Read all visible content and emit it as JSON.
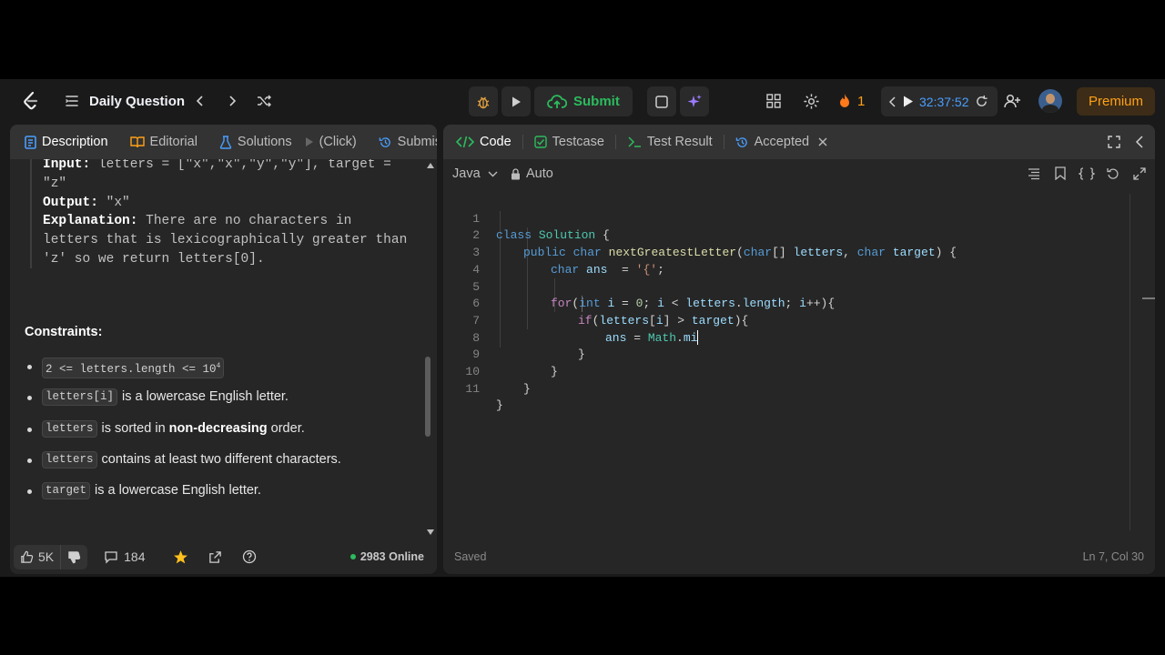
{
  "topbar": {
    "title": "Daily Question",
    "submit_label": "Submit",
    "streak_count": "1",
    "timer": "32:37:52",
    "premium_label": "Premium"
  },
  "left_tabs": [
    {
      "label": "Description",
      "icon": "description-icon"
    },
    {
      "label": "Editorial",
      "icon": "book-icon"
    },
    {
      "label": "Solutions",
      "icon": "flask-icon"
    },
    {
      "label": "(Click)",
      "icon": "cursor-icon"
    },
    {
      "label": "Submiss",
      "icon": "history-icon"
    }
  ],
  "example": {
    "input_label": "Input:",
    "input_value": "letters = [\"x\",\"x\",\"y\",\"y\"], target = \"z\"",
    "output_label": "Output:",
    "output_value": "\"x\"",
    "explanation_label": "Explanation:",
    "explanation_value": "There are no characters in letters that is lexicographically greater than 'z' so we return letters[0]."
  },
  "constraints": {
    "title": "Constraints:",
    "items": [
      {
        "code": "2 <= letters.length <= 10",
        "sup": "4",
        "text": ""
      },
      {
        "code": "letters[i]",
        "text": "is a lowercase English letter."
      },
      {
        "code": "letters",
        "text_before": "is sorted in ",
        "bold": "non-decreasing",
        "text_after": " order."
      },
      {
        "code": "letters",
        "text": "contains at least two different characters."
      },
      {
        "code": "target",
        "text": "is a lowercase English letter."
      }
    ]
  },
  "left_footer": {
    "likes": "5K",
    "comments": "184",
    "online": "2983 Online"
  },
  "right_tabs": [
    {
      "label": "Code",
      "icon": "code-icon"
    },
    {
      "label": "Testcase",
      "icon": "checkbox-icon"
    },
    {
      "label": "Test Result",
      "icon": "terminal-icon"
    },
    {
      "label": "Accepted",
      "icon": "history-icon"
    }
  ],
  "editor_toolbar": {
    "language": "Java",
    "mode": "Auto"
  },
  "code_lines": [
    "1",
    "2",
    "3",
    "4",
    "5",
    "6",
    "7",
    "8",
    "9",
    "10",
    "11"
  ],
  "code_text": {
    "l1_kw": "class",
    "l1_ty": "Solution",
    "l1_rest": " {",
    "l2_kw1": "public",
    "l2_kw2": "char",
    "l2_fn": "nextGreatestLetter",
    "l2_p1": "(",
    "l2_kw3": "char",
    "l2_p2": "[] ",
    "l2_v1": "letters",
    "l2_p3": ", ",
    "l2_kw4": "char",
    "l2_v2": "target",
    "l2_p4": ") {",
    "l3_kw": "char",
    "l3_v": "ans",
    "l3_op": "  = ",
    "l3_st": "'{'",
    "l3_end": ";",
    "l5_kw": "for",
    "l5_p1": "(",
    "l5_kw2": "int",
    "l5_v1": "i",
    "l5_p2": " = ",
    "l5_n": "0",
    "l5_p3": "; ",
    "l5_v2": "i",
    "l5_p4": " < ",
    "l5_v3": "letters",
    "l5_p5": ".",
    "l5_v4": "length",
    "l5_p6": "; ",
    "l5_v5": "i",
    "l5_p7": "++){",
    "l6_kw": "if",
    "l6_p1": "(",
    "l6_v1": "letters",
    "l6_p2": "[",
    "l6_v2": "i",
    "l6_p3": "] > ",
    "l6_v3": "target",
    "l6_p4": "){",
    "l7_v1": "ans",
    "l7_p1": " = ",
    "l7_ty": "Math",
    "l7_p2": ".",
    "l7_v2": "mi",
    "l8": "}",
    "l9": "}",
    "l10": "}",
    "l11": "}"
  },
  "editor_footer": {
    "status": "Saved",
    "position": "Ln 7, Col 30"
  },
  "colors": {
    "submit": "#2cbb5d",
    "premium": "#ffa116",
    "timer": "#4a9eff",
    "online_dot": "#2cbb5d"
  }
}
